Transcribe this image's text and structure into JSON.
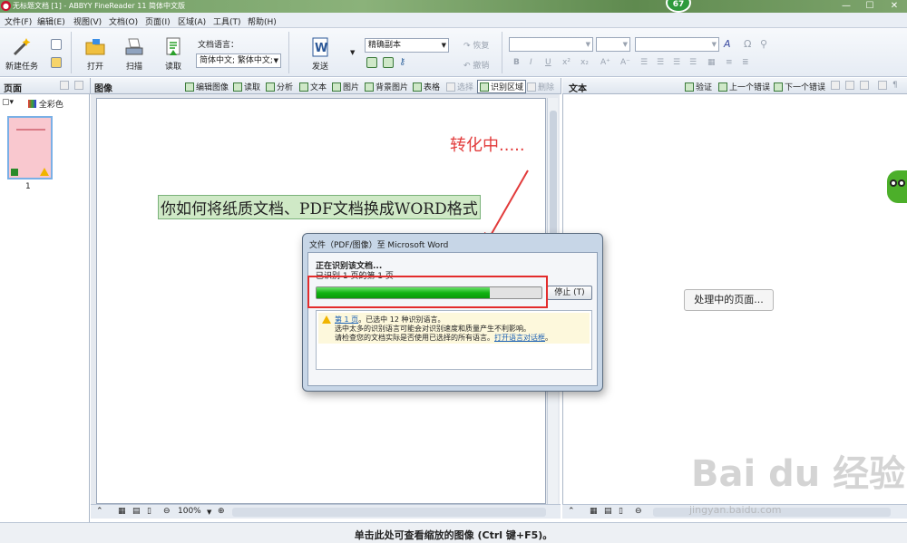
{
  "window": {
    "title": "无标题文档 [1] - ABBYY FineReader 11 简体中文版",
    "badge": "67",
    "min": "—",
    "max": "☐",
    "close": "✕"
  },
  "menu": [
    "文件(F)",
    "编辑(E)",
    "视图(V)",
    "文档(O)",
    "页面(I)",
    "区域(A)",
    "工具(T)",
    "帮助(H)"
  ],
  "toolbar": {
    "new_task": "新建任务",
    "open": "打开",
    "scan": "扫描",
    "read": "读取",
    "doc_lang_label": "文档语言：",
    "doc_lang_value": "简体中文; 繁体中文;",
    "send": "发送",
    "layout_mode": "精确副本",
    "restore": "恢复",
    "undo": "撤销"
  },
  "pages_pane": {
    "title": "页面",
    "color_mode": "全彩色",
    "page_number": "1"
  },
  "image_pane": {
    "title": "图像",
    "actions": [
      "编辑图像",
      "读取",
      "分析",
      "文本",
      "图片",
      "背景图片",
      "表格",
      "选择",
      "识别区域",
      "删除"
    ],
    "doc_text": "你如何将纸质文档、PDF文档换成WORD格式",
    "zoom": "100%"
  },
  "text_pane": {
    "title": "文本",
    "verify": "验证",
    "prev_error": "上一个错误",
    "next_error": "下一个错误",
    "processing": "处理中的页面..."
  },
  "dialog": {
    "title": "文件（PDF/图像）至 Microsoft Word",
    "status": "正在识别该文档...",
    "substatus": "已识别 1 页的第 1 页",
    "progress": 0.77,
    "stop": "停止 (T)",
    "warn_link": "第 1 页",
    "warn_line1": "。已选中 12 种识别语言。",
    "warn_line2": "选中太多的识别语言可能会对识别速度和质量产生不利影响。",
    "warn_line3": "请检查您的文档实际是否使用已选择的所有语言。",
    "warn_link2": "打开语言对话框",
    "warn_tail": "。"
  },
  "annotation": "转化中.....",
  "status_bar": "单击此处可查看缩放的图像 (Ctrl 键+F5)。",
  "watermark": "Bai du 经验",
  "watermark_url": "jingyan.baidu.com",
  "colors": {
    "accent_green": "#11b311",
    "annotation_red": "#e23b3b"
  }
}
